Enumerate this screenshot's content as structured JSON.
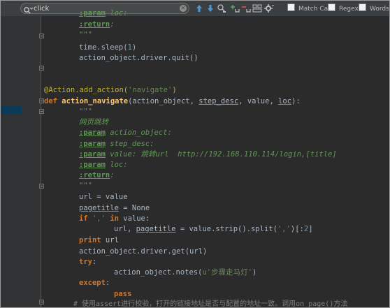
{
  "search": {
    "value": "click",
    "options": {
      "match_case": "Match Case",
      "regex": "Regex",
      "words": "Words"
    }
  },
  "icons": {
    "search": "search-icon",
    "clear": "clear-icon",
    "prev": "arrow-up-icon",
    "next": "arrow-down-icon",
    "find_all": "find-all-icon",
    "add_selection": "add-selection-icon",
    "remove_selection": "remove-selection-icon",
    "select_all": "select-all-occurrences-icon",
    "filter": "filter-settings-icon"
  },
  "colors": {
    "keyword": "#cc7832",
    "string": "#6a8759",
    "docstring": "#629755",
    "decorator": "#bbb529",
    "function": "#ffc66d",
    "number": "#6897bb",
    "background": "#2b2b2b"
  },
  "code": {
    "l01_tag": ":param",
    "l01_rest": " loc:",
    "l02_tag": ":return",
    "l02_rest": ":",
    "l03": "\"\"\"",
    "l04_a": "time.sleep(",
    "l04_num": "1",
    "l04_b": ")",
    "l05": "action_object.driver.quit()",
    "l06_a": "@Action.add_action(",
    "l06_str": "'navigate'",
    "l06_b": ")",
    "l07_def": "def",
    "l07_fn": "action_navigate",
    "l07_a": "(action_object, ",
    "l07_p1": "step_desc",
    "l07_b": ", value, ",
    "l07_p2": "loc",
    "l07_c": "):",
    "l08": "\"\"\"",
    "l09": "网页跳转",
    "l10_tag": ":param",
    "l10_rest": " action_object:",
    "l11_tag": ":param",
    "l11_rest": " step_desc:",
    "l12_tag": ":param",
    "l12_rest": " value: 跳转url  http://192.168.110.114/login,[title]",
    "l13_tag": ":param",
    "l13_rest": " loc:",
    "l14_tag": ":return",
    "l14_rest": ":",
    "l15": "\"\"\"",
    "l16": "url = value",
    "l17_p": "pagetitle",
    "l17_rest": " = None",
    "l18_if": "if",
    "l18_sp": " ",
    "l18_str": "','",
    "l18_in": " in",
    "l18_rest": " value:",
    "l19_a": "url, ",
    "l19_p": "pagetitle",
    "l19_b": " = value.strip().split(",
    "l19_str": "','",
    "l19_c": ")[:",
    "l19_num": "2",
    "l19_d": "]",
    "l20_kw": "print",
    "l20_rest": " url",
    "l21": "action_object.driver.get(url)",
    "l22_kw": "try",
    "l22_rest": ":",
    "l23_a": "action_object.notes(",
    "l23_str": "u'步骤走马灯'",
    "l23_b": ")",
    "l24_kw": "except",
    "l24_rest": ":",
    "l25_kw": "pass",
    "l26": "# 使用assert进行校验，打开的链接地址是否与配置的地址一致。调用on_page()方法"
  }
}
